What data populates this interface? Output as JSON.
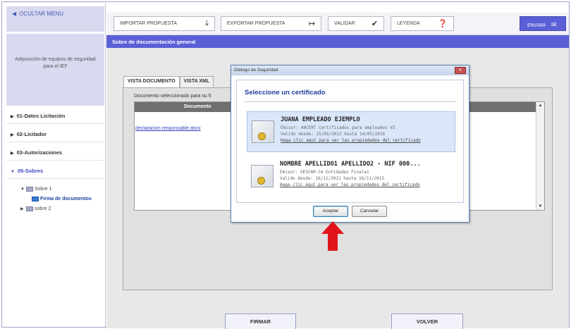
{
  "sidebar": {
    "toggle_label": "OCULTAR MENU",
    "title": "Adquisición de equipos de seguridad para el IEF",
    "nav": [
      {
        "label": "01-Datos Licitación"
      },
      {
        "label": "02-Licitador"
      },
      {
        "label": "03-Autorizaciones"
      },
      {
        "label": "05-Sobres"
      }
    ],
    "tree": {
      "sobre1": "Sobre 1",
      "firma": "Firma de documentos",
      "sobre2": "sobre 2"
    }
  },
  "toolbar": {
    "importar": "IMPORTAR PROPUESTA",
    "exportar": "EXPORTAR PROPUESTA",
    "validar": "VALIDAR",
    "leyenda": "LEYENDA",
    "enviar": "ENVIAR"
  },
  "panel": {
    "header": "Sobre de documentación general",
    "heading_partial": "...",
    "tabs": [
      "VISTA DOCUMENTO",
      "VISTA XML"
    ],
    "doc_select_label": "Documento seleccionado para su fi",
    "table_header": "Documento",
    "doc_link": "declaracion responsable.docx"
  },
  "bottom": {
    "firmar": "FIRMAR",
    "volver": "VOLVER"
  },
  "dialog": {
    "title": "Diálogo de Seguridad",
    "heading": "Seleccione un certificado",
    "certs": [
      {
        "name": "JUANA EMPLEADO EJEMPLO",
        "issuer": "Emisor: ANCERT Certificados para empleados V2",
        "validity": "Valido desde: 15/05/2013 hasta 14/05/2016",
        "link": "Haga clic aquí para ver las propiedades del certificado"
      },
      {
        "name": "NOMBRE APELLIDO1 APELLIDO2 - NIF 000...",
        "issuer": "Emisor: SESCAM CA Entidades Finales",
        "validity": "Valido desde: 16/11/2011 hasta 16/11/2015",
        "link": "Haga clic aquí para ver las propiedades del certificado"
      }
    ],
    "accept": "Aceptar",
    "cancel": "Cancelar"
  },
  "colors": {
    "accent": "#5a5fd6",
    "sidebar_block": "#d9daf0",
    "dialog_heading": "#1e3b9c",
    "pointer_arrow": "#e0141b"
  },
  "icons": {
    "importar": "download-icon",
    "exportar": "export-icon",
    "validar": "check-icon",
    "leyenda": "help-icon",
    "enviar": "send-icon",
    "annotation": "red-up-arrow"
  }
}
